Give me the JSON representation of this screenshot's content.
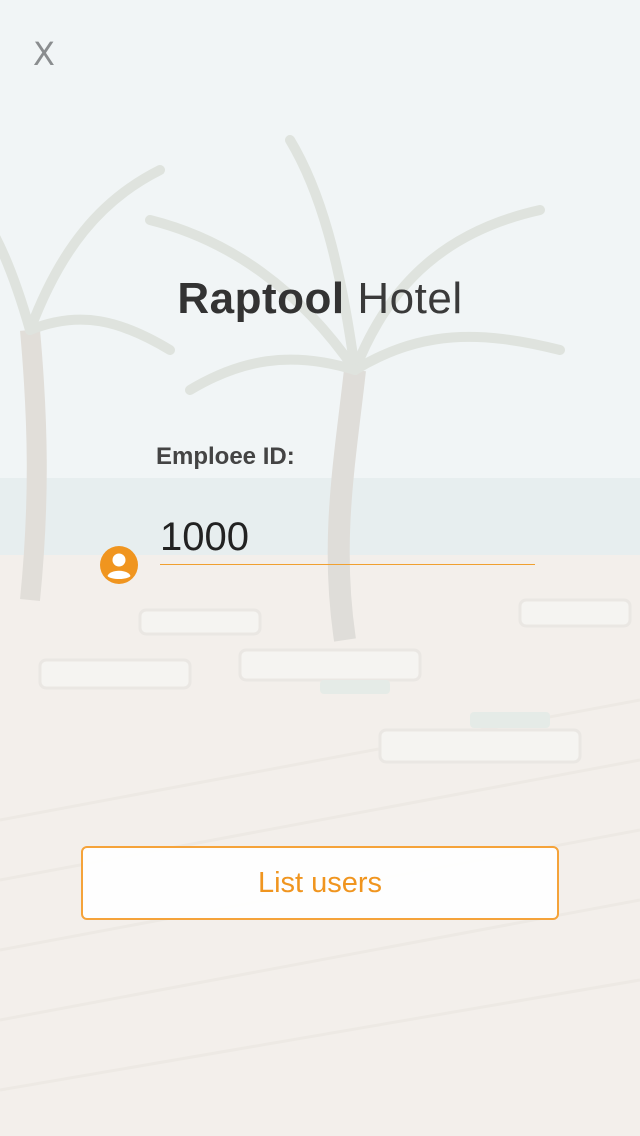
{
  "header": {
    "close_label": "X"
  },
  "brand": {
    "name_bold": "Raptool",
    "name_light": "Hotel"
  },
  "form": {
    "employee_id_label": "Emploee ID:",
    "employee_id_value": "1000"
  },
  "actions": {
    "list_users_label": "List users"
  },
  "colors": {
    "accent": "#f5a33a",
    "icon": "#f0951f",
    "text_dark": "#333333"
  },
  "icons": {
    "user": "account-circle-icon",
    "close": "close-icon"
  }
}
